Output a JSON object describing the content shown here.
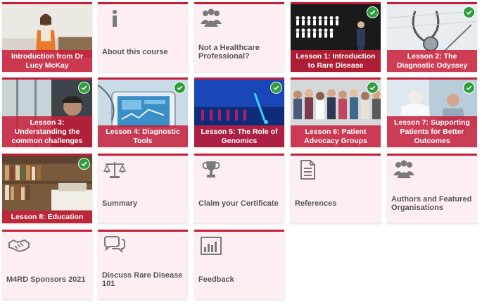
{
  "tiles": [
    {
      "label": "Introduction from Dr Lucy McKay"
    },
    {
      "label": "About this course"
    },
    {
      "label": "Not a Healthcare Professional?"
    },
    {
      "label": "Lesson 1: Introduction to Rare Disease"
    },
    {
      "label": "Lesson 2: The Diagnostic Odyssey"
    },
    {
      "label": "Lesson 3: Understanding the common challenges"
    },
    {
      "label": "Lesson 4: Diagnostic Tools"
    },
    {
      "label": "Lesson 5: The Role of Genomics"
    },
    {
      "label": "Lesson 6: Patient Advocacy Groups"
    },
    {
      "label": "Lesson 7: Supporting Patients for Better Outcomes"
    },
    {
      "label": "Lesson 8: Education"
    },
    {
      "label": "Summary"
    },
    {
      "label": "Claim your Certificate"
    },
    {
      "label": "References"
    },
    {
      "label": "Authors and Featured Organisations"
    },
    {
      "label": "M4RD Sponsors 2021"
    },
    {
      "label": "Discuss Rare Disease 101"
    },
    {
      "label": "Feedback"
    }
  ],
  "colors": {
    "accent": "#c41e3a",
    "tile_bg": "#fdeff1",
    "complete": "#2e9d3e",
    "text": "#555555"
  },
  "icons": [
    "info-icon",
    "people-icon",
    "scales-icon",
    "trophy-icon",
    "document-icon",
    "group-icon",
    "handshake-icon",
    "chat-icon",
    "bar-chart-icon"
  ]
}
